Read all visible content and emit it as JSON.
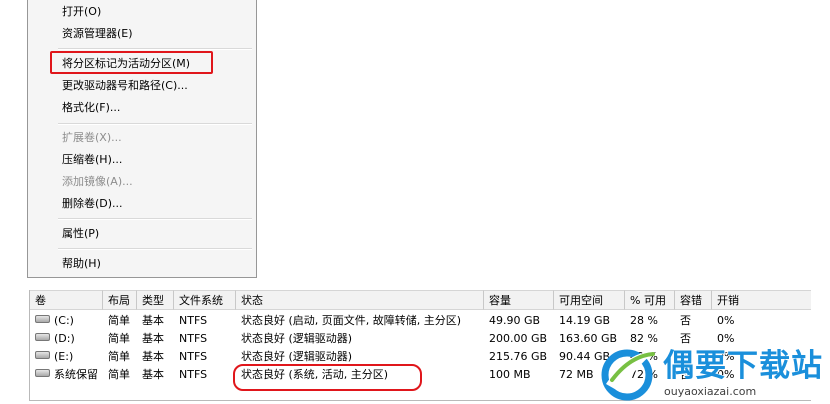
{
  "context_menu": {
    "items": [
      {
        "label": "打开(O)",
        "enabled": true
      },
      {
        "label": "资源管理器(E)",
        "enabled": true
      },
      {
        "label": "将分区标记为活动分区(M)",
        "enabled": true
      },
      {
        "label": "更改驱动器号和路径(C)...",
        "enabled": true
      },
      {
        "label": "格式化(F)...",
        "enabled": true
      },
      {
        "label": "扩展卷(X)...",
        "enabled": false
      },
      {
        "label": "压缩卷(H)...",
        "enabled": true
      },
      {
        "label": "添加镜像(A)...",
        "enabled": false
      },
      {
        "label": "删除卷(D)...",
        "enabled": true
      },
      {
        "label": "属性(P)",
        "enabled": true
      },
      {
        "label": "帮助(H)",
        "enabled": true
      }
    ]
  },
  "volume_table": {
    "columns": [
      "卷",
      "布局",
      "类型",
      "文件系统",
      "状态",
      "容量",
      "可用空间",
      "% 可用",
      "容错",
      "开销"
    ],
    "rows": [
      [
        "(C:)",
        "简单",
        "基本",
        "NTFS",
        "状态良好 (启动, 页面文件, 故障转储, 主分区)",
        "49.90 GB",
        "14.19 GB",
        "28 %",
        "否",
        "0%"
      ],
      [
        "(D:)",
        "简单",
        "基本",
        "NTFS",
        "状态良好 (逻辑驱动器)",
        "200.00 GB",
        "163.60 GB",
        "82 %",
        "否",
        "0%"
      ],
      [
        "(E:)",
        "简单",
        "基本",
        "NTFS",
        "状态良好 (逻辑驱动器)",
        "215.76 GB",
        "90.44 GB",
        "42 %",
        "否",
        "0%"
      ],
      [
        "系统保留",
        "简单",
        "基本",
        "NTFS",
        "状态良好 (系统, 活动, 主分区)",
        "100 MB",
        "72 MB",
        "72 %",
        "否",
        "0%"
      ]
    ]
  },
  "watermark": {
    "text": "偶要下载站",
    "url": "ouyaoxiazai.com"
  },
  "colors": {
    "highlight_red": "#e0161b",
    "watermark_blue": "#1a8fdb"
  }
}
